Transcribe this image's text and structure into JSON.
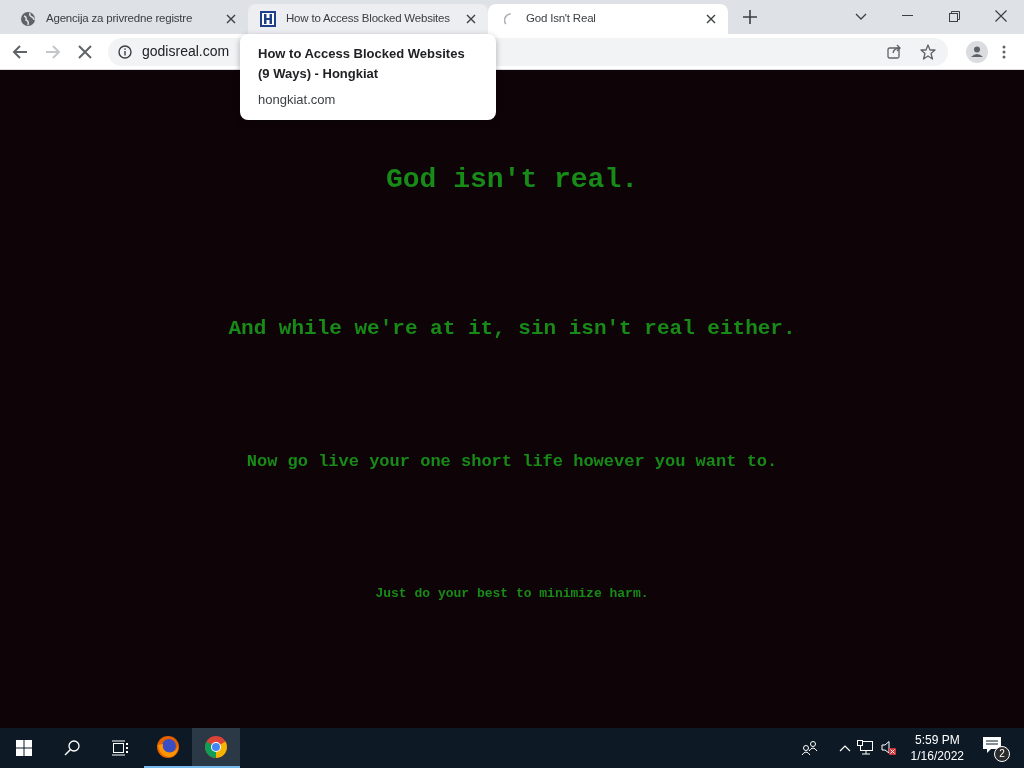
{
  "tabs": [
    {
      "title": "Agencija za privredne registre",
      "kind": "globe",
      "selected": false,
      "hovered": false
    },
    {
      "title": "How to Access Blocked Websites",
      "kind": "logo",
      "selected": false,
      "hovered": true
    },
    {
      "title": "God Isn't Real",
      "kind": "spinner",
      "selected": true,
      "hovered": false
    }
  ],
  "tooltip": {
    "title": "How to Access Blocked Websites (9 Ways) - Hongkiat",
    "domain": "hongkiat.com"
  },
  "toolbar": {
    "url": "godisreal.com",
    "loading": true,
    "forward_disabled": true
  },
  "page": {
    "lines": [
      "God isn't real.",
      "And while we're at it, sin isn't real either.",
      "Now go live your one short life however you want to.",
      "Just do your best to minimize harm."
    ]
  },
  "taskbar": {
    "apps": [
      {
        "kind": "firefox",
        "selected": false
      },
      {
        "kind": "chrome",
        "selected": true
      }
    ],
    "time": "5:59 PM",
    "date": "1/16/2022",
    "notifications": "2"
  }
}
